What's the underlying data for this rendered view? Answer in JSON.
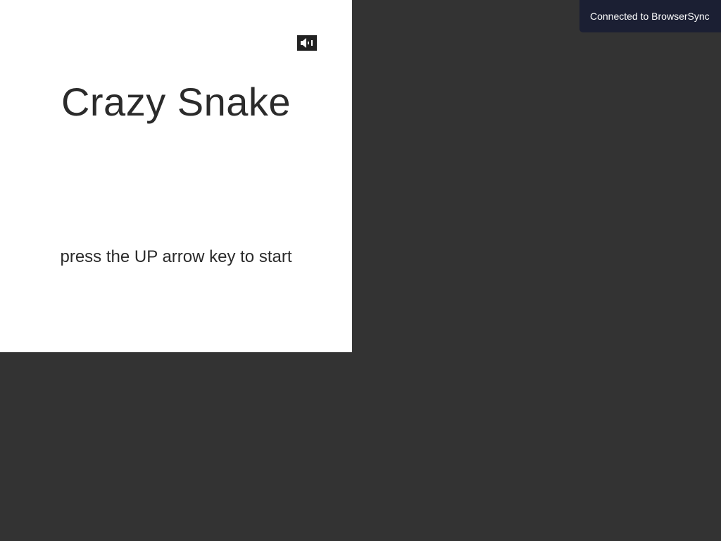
{
  "game": {
    "title": "Crazy Snake",
    "start_hint": "press the UP arrow key to start",
    "mute_icon": "speaker-mute-icon"
  },
  "notification": {
    "text": "Connected to BrowserSync"
  },
  "colors": {
    "page_background": "#333333",
    "panel_background": "#ffffff",
    "text": "#2b2b2b",
    "notification_background": "#1b1f33"
  }
}
